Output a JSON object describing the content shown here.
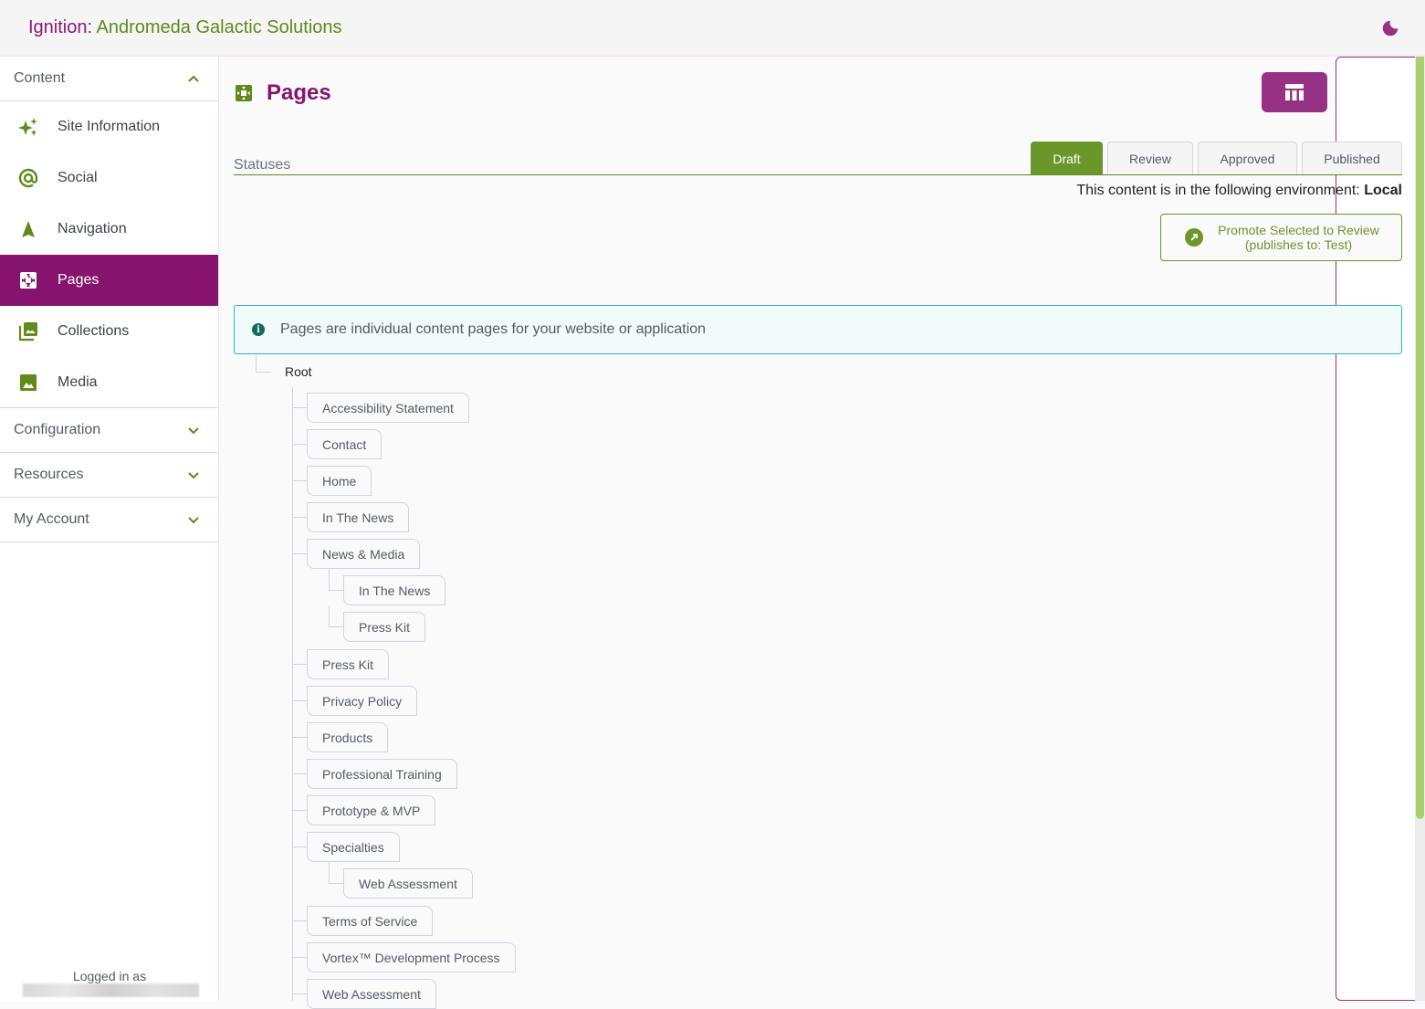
{
  "header": {
    "brand": "Ignition:",
    "org": "Andromeda Galactic Solutions",
    "theme_toggle_icon": "moon-icon"
  },
  "sidebar": {
    "sections": [
      {
        "label": "Content",
        "expanded": true,
        "icon": "chevron-up-icon"
      },
      {
        "label": "Configuration",
        "expanded": false,
        "icon": "chevron-down-icon"
      },
      {
        "label": "Resources",
        "expanded": false,
        "icon": "chevron-down-icon"
      },
      {
        "label": "My Account",
        "expanded": false,
        "icon": "chevron-down-icon"
      }
    ],
    "items": [
      {
        "label": "Site Information",
        "icon": "sparkles-icon"
      },
      {
        "label": "Social",
        "icon": "at-sign-icon"
      },
      {
        "label": "Navigation",
        "icon": "navigation-arrow-icon"
      },
      {
        "label": "Pages",
        "icon": "pages-icon",
        "active": true
      },
      {
        "label": "Collections",
        "icon": "collections-icon"
      },
      {
        "label": "Media",
        "icon": "image-icon"
      }
    ],
    "logged_in_label": "Logged in as"
  },
  "main": {
    "title": "Pages",
    "title_icon": "pages-icon",
    "view_buttons": [
      {
        "name": "table-view",
        "icon": "table-icon",
        "active": true
      },
      {
        "name": "tree-view",
        "icon": "tree-icon",
        "active": false
      }
    ],
    "statuses_label": "Statuses",
    "tabs": [
      {
        "label": "Draft",
        "active": true
      },
      {
        "label": "Review",
        "active": false
      },
      {
        "label": "Approved",
        "active": false
      },
      {
        "label": "Published",
        "active": false
      }
    ],
    "environment_text": "This content is in the following environment:",
    "environment_value": "Local",
    "promote_line1": "Promote Selected to Review",
    "promote_line2": "(publishes to: Test)",
    "info_text": "Pages are individual content pages for your website or application",
    "tree": {
      "root": "Root",
      "nodes": [
        {
          "label": "Accessibility Statement",
          "level": 1
        },
        {
          "label": "Contact",
          "level": 1
        },
        {
          "label": "Home",
          "level": 1
        },
        {
          "label": "In The News",
          "level": 1
        },
        {
          "label": "News & Media",
          "level": 1
        },
        {
          "label": "In The News",
          "level": 2
        },
        {
          "label": "Press Kit",
          "level": 2
        },
        {
          "label": "Press Kit",
          "level": 1
        },
        {
          "label": "Privacy Policy",
          "level": 1
        },
        {
          "label": "Products",
          "level": 1
        },
        {
          "label": "Professional Training",
          "level": 1
        },
        {
          "label": "Prototype & MVP",
          "level": 1
        },
        {
          "label": "Specialties",
          "level": 1
        },
        {
          "label": "Web Assessment",
          "level": 2
        },
        {
          "label": "Terms of Service",
          "level": 1
        },
        {
          "label": "Vortex™ Development Process",
          "level": 1
        },
        {
          "label": "Web Assessment",
          "level": 1
        }
      ]
    }
  },
  "colors": {
    "brand_purple": "#86146f",
    "brand_green": "#5f8a1c",
    "tab_active": "#6b962a",
    "info_border": "#2cbdb2"
  }
}
